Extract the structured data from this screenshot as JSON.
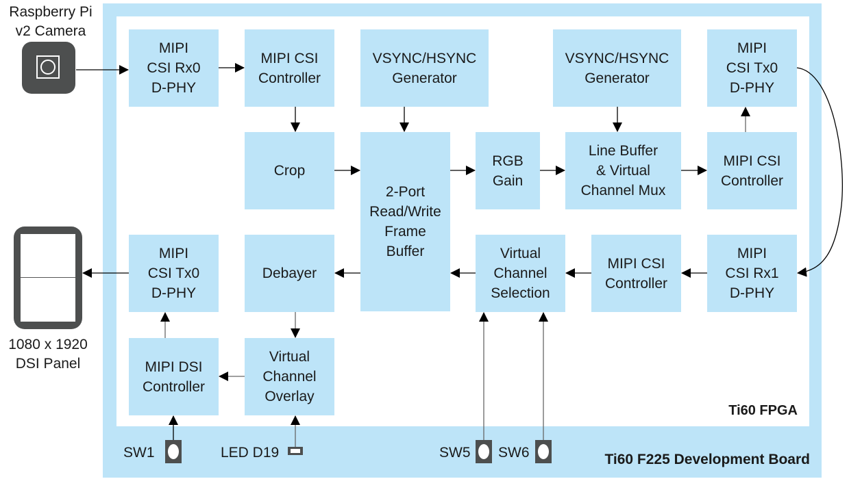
{
  "colors": {
    "block_fill": "#bde4f8",
    "board_fill": "#bde4f8",
    "fpga_fill": "#ffffff",
    "device_dark": "#4d4f4f",
    "arrow": "#000000"
  },
  "external": {
    "camera_label": "Raspberry Pi\nv2 Camera",
    "panel_label": "1080 x 1920\nDSI Panel"
  },
  "board": {
    "fpga_label": "Ti60 FPGA",
    "board_label": "Ti60 F225 Development Board",
    "sw1": "SW1",
    "led": "LED D19",
    "sw5": "SW5",
    "sw6": "SW6"
  },
  "blocks": {
    "csi_rx0": "MIPI\nCSI Rx0\nD-PHY",
    "csi_ctrl_in": "MIPI CSI\nController",
    "vsync_gen_1": "VSYNC/HSYNC\nGenerator",
    "vsync_gen_2": "VSYNC/HSYNC\nGenerator",
    "csi_tx0_top": "MIPI\nCSI Tx0\nD-PHY",
    "crop": "Crop",
    "frame_buffer": "2-Port\nRead/Write\nFrame\nBuffer",
    "rgb_gain": "RGB\nGain",
    "line_buffer": "Line Buffer\n& Virtual\nChannel Mux",
    "csi_ctrl_out": "MIPI CSI\nController",
    "csi_tx0_bottom": "MIPI\nCSI Tx0\nD-PHY",
    "debayer": "Debayer",
    "vc_selection": "Virtual\nChannel\nSelection",
    "csi_ctrl_rx1": "MIPI CSI\nController",
    "csi_rx1": "MIPI\nCSI Rx1\nD-PHY",
    "dsi_ctrl": "MIPI DSI\nController",
    "vc_overlay": "Virtual\nChannel\nOverlay"
  }
}
